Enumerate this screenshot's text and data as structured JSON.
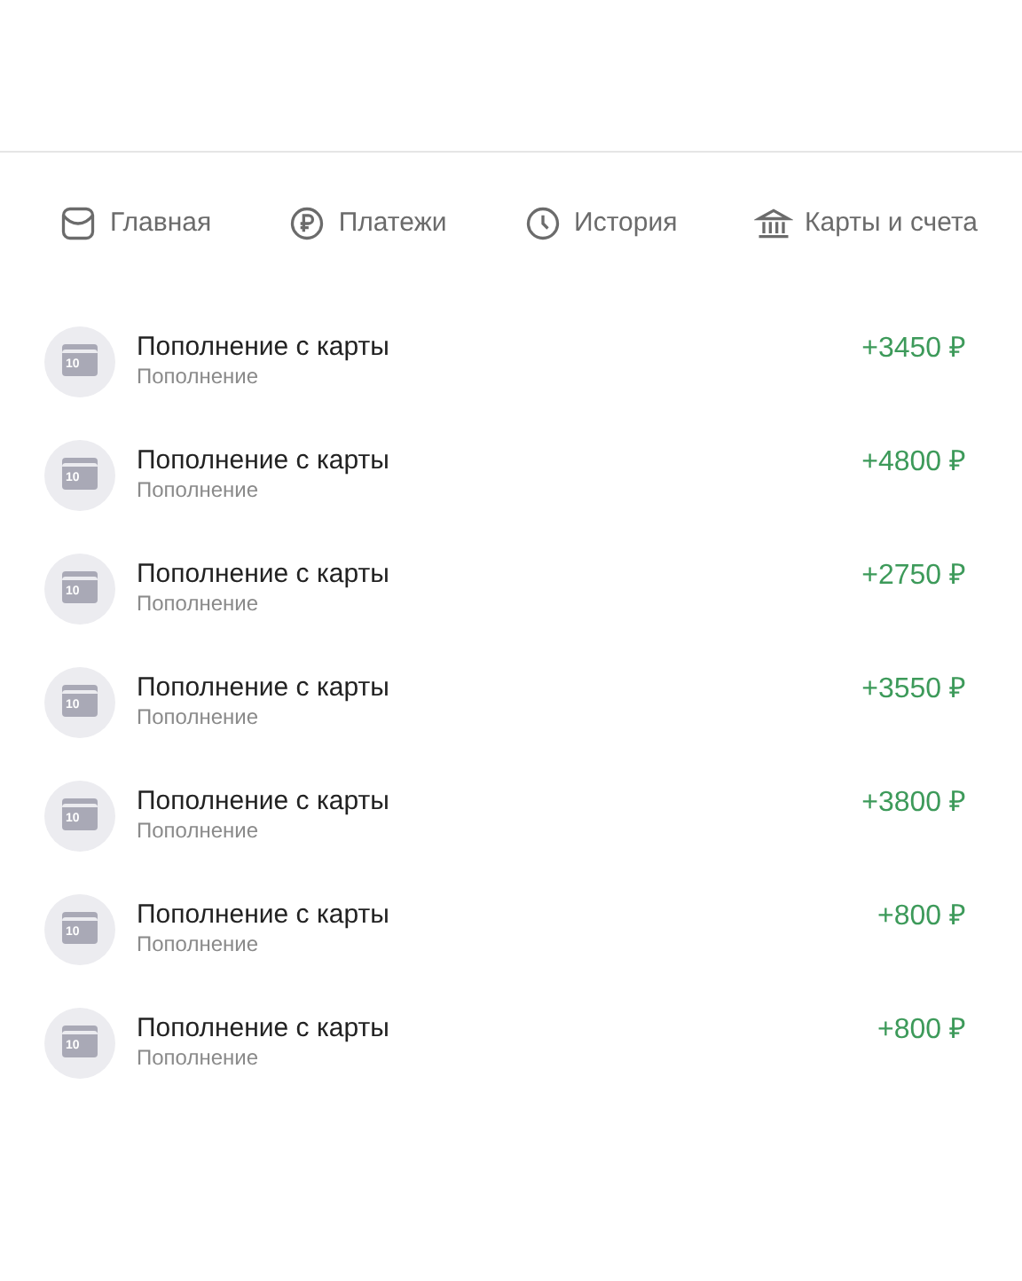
{
  "nav": [
    {
      "label": "Главная"
    },
    {
      "label": "Платежи"
    },
    {
      "label": "История"
    },
    {
      "label": "Карты и счета"
    }
  ],
  "transactions": [
    {
      "title": "Пополнение с карты",
      "subtitle": "Пополнение",
      "amount": "+3450 ₽",
      "icon_label": "10"
    },
    {
      "title": "Пополнение с карты",
      "subtitle": "Пополнение",
      "amount": "+4800 ₽",
      "icon_label": "10"
    },
    {
      "title": "Пополнение с карты",
      "subtitle": "Пополнение",
      "amount": "+2750 ₽",
      "icon_label": "10"
    },
    {
      "title": "Пополнение с карты",
      "subtitle": "Пополнение",
      "amount": "+3550 ₽",
      "icon_label": "10"
    },
    {
      "title": "Пополнение с карты",
      "subtitle": "Пополнение",
      "amount": "+3800 ₽",
      "icon_label": "10"
    },
    {
      "title": "Пополнение с карты",
      "subtitle": "Пополнение",
      "amount": "+800 ₽",
      "icon_label": "10"
    },
    {
      "title": "Пополнение с карты",
      "subtitle": "Пополнение",
      "amount": "+800 ₽",
      "icon_label": "10"
    }
  ]
}
